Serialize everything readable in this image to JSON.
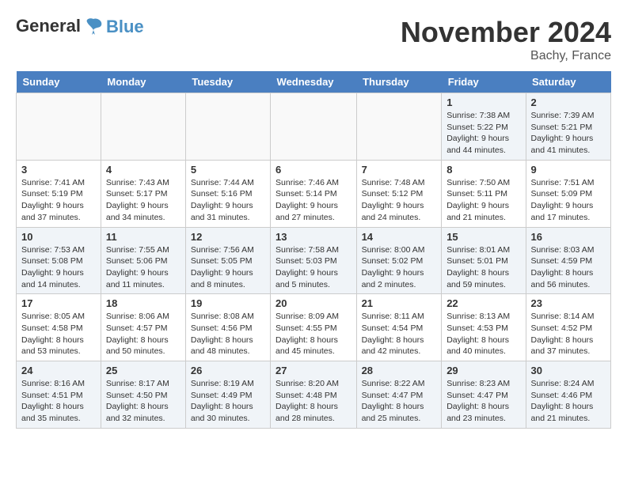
{
  "header": {
    "logo_line1": "General",
    "logo_line2": "Blue",
    "month": "November 2024",
    "location": "Bachy, France"
  },
  "weekdays": [
    "Sunday",
    "Monday",
    "Tuesday",
    "Wednesday",
    "Thursday",
    "Friday",
    "Saturday"
  ],
  "weeks": [
    [
      {
        "day": "",
        "info": ""
      },
      {
        "day": "",
        "info": ""
      },
      {
        "day": "",
        "info": ""
      },
      {
        "day": "",
        "info": ""
      },
      {
        "day": "",
        "info": ""
      },
      {
        "day": "1",
        "info": "Sunrise: 7:38 AM\nSunset: 5:22 PM\nDaylight: 9 hours and 44 minutes."
      },
      {
        "day": "2",
        "info": "Sunrise: 7:39 AM\nSunset: 5:21 PM\nDaylight: 9 hours and 41 minutes."
      }
    ],
    [
      {
        "day": "3",
        "info": "Sunrise: 7:41 AM\nSunset: 5:19 PM\nDaylight: 9 hours and 37 minutes."
      },
      {
        "day": "4",
        "info": "Sunrise: 7:43 AM\nSunset: 5:17 PM\nDaylight: 9 hours and 34 minutes."
      },
      {
        "day": "5",
        "info": "Sunrise: 7:44 AM\nSunset: 5:16 PM\nDaylight: 9 hours and 31 minutes."
      },
      {
        "day": "6",
        "info": "Sunrise: 7:46 AM\nSunset: 5:14 PM\nDaylight: 9 hours and 27 minutes."
      },
      {
        "day": "7",
        "info": "Sunrise: 7:48 AM\nSunset: 5:12 PM\nDaylight: 9 hours and 24 minutes."
      },
      {
        "day": "8",
        "info": "Sunrise: 7:50 AM\nSunset: 5:11 PM\nDaylight: 9 hours and 21 minutes."
      },
      {
        "day": "9",
        "info": "Sunrise: 7:51 AM\nSunset: 5:09 PM\nDaylight: 9 hours and 17 minutes."
      }
    ],
    [
      {
        "day": "10",
        "info": "Sunrise: 7:53 AM\nSunset: 5:08 PM\nDaylight: 9 hours and 14 minutes."
      },
      {
        "day": "11",
        "info": "Sunrise: 7:55 AM\nSunset: 5:06 PM\nDaylight: 9 hours and 11 minutes."
      },
      {
        "day": "12",
        "info": "Sunrise: 7:56 AM\nSunset: 5:05 PM\nDaylight: 9 hours and 8 minutes."
      },
      {
        "day": "13",
        "info": "Sunrise: 7:58 AM\nSunset: 5:03 PM\nDaylight: 9 hours and 5 minutes."
      },
      {
        "day": "14",
        "info": "Sunrise: 8:00 AM\nSunset: 5:02 PM\nDaylight: 9 hours and 2 minutes."
      },
      {
        "day": "15",
        "info": "Sunrise: 8:01 AM\nSunset: 5:01 PM\nDaylight: 8 hours and 59 minutes."
      },
      {
        "day": "16",
        "info": "Sunrise: 8:03 AM\nSunset: 4:59 PM\nDaylight: 8 hours and 56 minutes."
      }
    ],
    [
      {
        "day": "17",
        "info": "Sunrise: 8:05 AM\nSunset: 4:58 PM\nDaylight: 8 hours and 53 minutes."
      },
      {
        "day": "18",
        "info": "Sunrise: 8:06 AM\nSunset: 4:57 PM\nDaylight: 8 hours and 50 minutes."
      },
      {
        "day": "19",
        "info": "Sunrise: 8:08 AM\nSunset: 4:56 PM\nDaylight: 8 hours and 48 minutes."
      },
      {
        "day": "20",
        "info": "Sunrise: 8:09 AM\nSunset: 4:55 PM\nDaylight: 8 hours and 45 minutes."
      },
      {
        "day": "21",
        "info": "Sunrise: 8:11 AM\nSunset: 4:54 PM\nDaylight: 8 hours and 42 minutes."
      },
      {
        "day": "22",
        "info": "Sunrise: 8:13 AM\nSunset: 4:53 PM\nDaylight: 8 hours and 40 minutes."
      },
      {
        "day": "23",
        "info": "Sunrise: 8:14 AM\nSunset: 4:52 PM\nDaylight: 8 hours and 37 minutes."
      }
    ],
    [
      {
        "day": "24",
        "info": "Sunrise: 8:16 AM\nSunset: 4:51 PM\nDaylight: 8 hours and 35 minutes."
      },
      {
        "day": "25",
        "info": "Sunrise: 8:17 AM\nSunset: 4:50 PM\nDaylight: 8 hours and 32 minutes."
      },
      {
        "day": "26",
        "info": "Sunrise: 8:19 AM\nSunset: 4:49 PM\nDaylight: 8 hours and 30 minutes."
      },
      {
        "day": "27",
        "info": "Sunrise: 8:20 AM\nSunset: 4:48 PM\nDaylight: 8 hours and 28 minutes."
      },
      {
        "day": "28",
        "info": "Sunrise: 8:22 AM\nSunset: 4:47 PM\nDaylight: 8 hours and 25 minutes."
      },
      {
        "day": "29",
        "info": "Sunrise: 8:23 AM\nSunset: 4:47 PM\nDaylight: 8 hours and 23 minutes."
      },
      {
        "day": "30",
        "info": "Sunrise: 8:24 AM\nSunset: 4:46 PM\nDaylight: 8 hours and 21 minutes."
      }
    ]
  ]
}
